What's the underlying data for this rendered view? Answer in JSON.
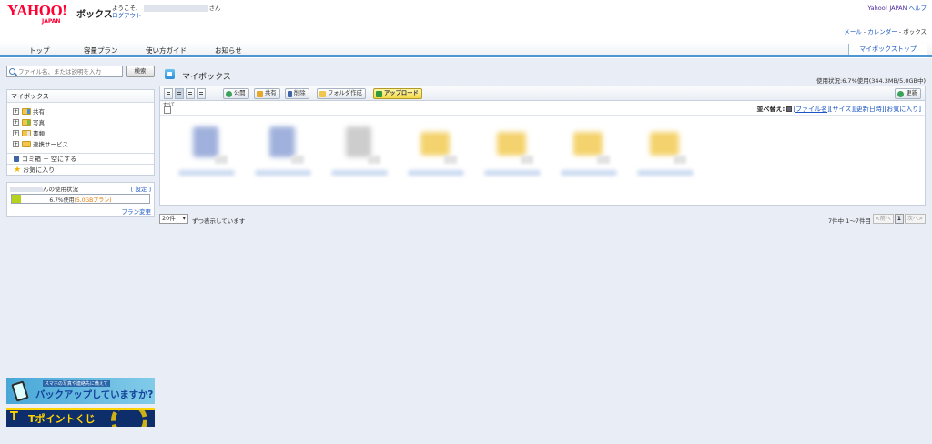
{
  "header": {
    "logo_text": "YAHOO!",
    "logo_sub": "JAPAN",
    "service_name": "ボックス",
    "welcome_prefix": "ようこそ、",
    "welcome_suffix": "さん",
    "logout": "ログアウト",
    "yahoo_japan_link": "Yahoo! JAPAN",
    "help_link": "ヘルプ",
    "mail_link": "メール",
    "calendar_link": "カレンダー",
    "box_label": "ボックス",
    "separator": " - "
  },
  "nav": {
    "tabs": [
      "トップ",
      "容量プラン",
      "使い方ガイド",
      "お知らせ"
    ],
    "mybox_top": "マイボックストップ"
  },
  "sidebar": {
    "search_placeholder": "ファイル名、または説明を入力",
    "search_button": "検索",
    "tree_title": "マイボックス",
    "tree_items": [
      "共有",
      "写真",
      "書類",
      "連携サービス"
    ],
    "trash_label": "ゴミ箱",
    "empty_trash": "空にする",
    "favorites": "お気に入り",
    "usage_title_suffix": "んの使用状況",
    "usage_settings": "[ 設定 ]",
    "usage_text": "6.7%使用",
    "usage_plan": "(5.0GBプラン)",
    "usage_fraction": 0.067,
    "plan_change": "プラン変更"
  },
  "banners": {
    "backup_small": "スマホの写真や連絡先に備えて",
    "backup_big": "バックアップしていますか?",
    "tpoint_t": "T",
    "tpoint_text": "Tポイントくじ"
  },
  "content": {
    "title": "マイボックス",
    "usage_status": "使用状況:6.7%使用(344.3MB/5.0GB中)",
    "toolbar": {
      "publish": "公開",
      "share": "共有",
      "delete": "削除",
      "new_folder": "フォルダ作成",
      "upload": "アップロード",
      "refresh": "更新"
    },
    "select_all": "すべて",
    "sort": {
      "label": "並べ替え:",
      "name": "ファイル名",
      "size": "サイズ",
      "updated": "更新日時",
      "favorite": "お気に入り"
    },
    "files": [
      {
        "kind": "doc-blue"
      },
      {
        "kind": "doc-blue"
      },
      {
        "kind": "doc-gray"
      },
      {
        "kind": "folder"
      },
      {
        "kind": "folder"
      },
      {
        "kind": "folder"
      },
      {
        "kind": "folder"
      }
    ],
    "per_page": "20件",
    "per_page_suffix": "ずつ表示しています",
    "count": "7件中 1～7件目",
    "pager": {
      "prev": "前へ",
      "current": "1",
      "next": "次へ"
    }
  },
  "colors": {
    "accent": "#4d96d3",
    "logo_red": "#ff0033",
    "link": "#1a56c4",
    "background": "#e9eef6",
    "usage_fill": "#b5d21d"
  }
}
